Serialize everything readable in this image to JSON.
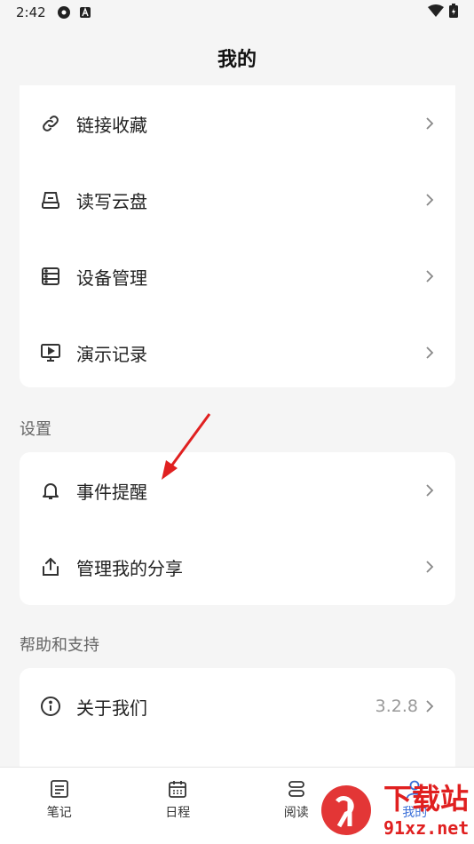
{
  "status_bar": {
    "time": "2:42"
  },
  "header": {
    "title": "我的"
  },
  "card_top": {
    "items": [
      {
        "label": "链接收藏",
        "icon": "link-icon"
      },
      {
        "label": "读写云盘",
        "icon": "cloud-drive-icon"
      },
      {
        "label": "设备管理",
        "icon": "device-icon"
      },
      {
        "label": "演示记录",
        "icon": "presentation-icon"
      }
    ]
  },
  "settings": {
    "title": "设置",
    "items": [
      {
        "label": "事件提醒",
        "icon": "bell-icon"
      },
      {
        "label": "管理我的分享",
        "icon": "share-icon"
      }
    ]
  },
  "help": {
    "title": "帮助和支持",
    "items": [
      {
        "label": "关于我们",
        "icon": "info-icon",
        "value": "3.2.8"
      }
    ]
  },
  "tabs": [
    {
      "label": "笔记",
      "icon": "notes-icon"
    },
    {
      "label": "日程",
      "icon": "calendar-icon"
    },
    {
      "label": "阅读",
      "icon": "reading-icon"
    },
    {
      "label": "我的",
      "icon": "profile-icon",
      "active": true
    }
  ],
  "watermark": {
    "text": "下载站",
    "domain": "91xz.net"
  },
  "colors": {
    "accent": "#3a6fd8",
    "arrow": "#e02020",
    "watermark": "#e02020"
  }
}
